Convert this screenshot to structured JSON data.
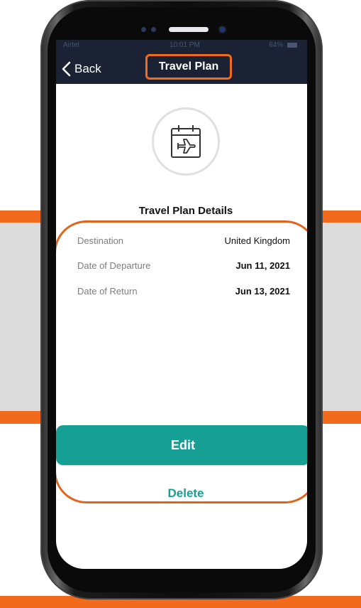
{
  "status_bar": {
    "carrier": "Airtel",
    "time": "10:01 PM",
    "battery": "64%"
  },
  "nav": {
    "back_label": "Back",
    "title": "Travel Plan"
  },
  "icons": {
    "back": "chevron-left-icon",
    "travel": "calendar-airplane-icon"
  },
  "details": {
    "title": "Travel Plan Details",
    "rows": [
      {
        "label": "Destination",
        "value": "United Kingdom"
      },
      {
        "label": "Date of Departure",
        "value": "Jun 11, 2021"
      },
      {
        "label": "Date of Return",
        "value": "Jun 13, 2021"
      }
    ]
  },
  "actions": {
    "edit_label": "Edit",
    "delete_label": "Delete"
  },
  "colors": {
    "accent": "#169f95",
    "highlight": "#f26a1b",
    "nav_bg": "#1b2233"
  }
}
